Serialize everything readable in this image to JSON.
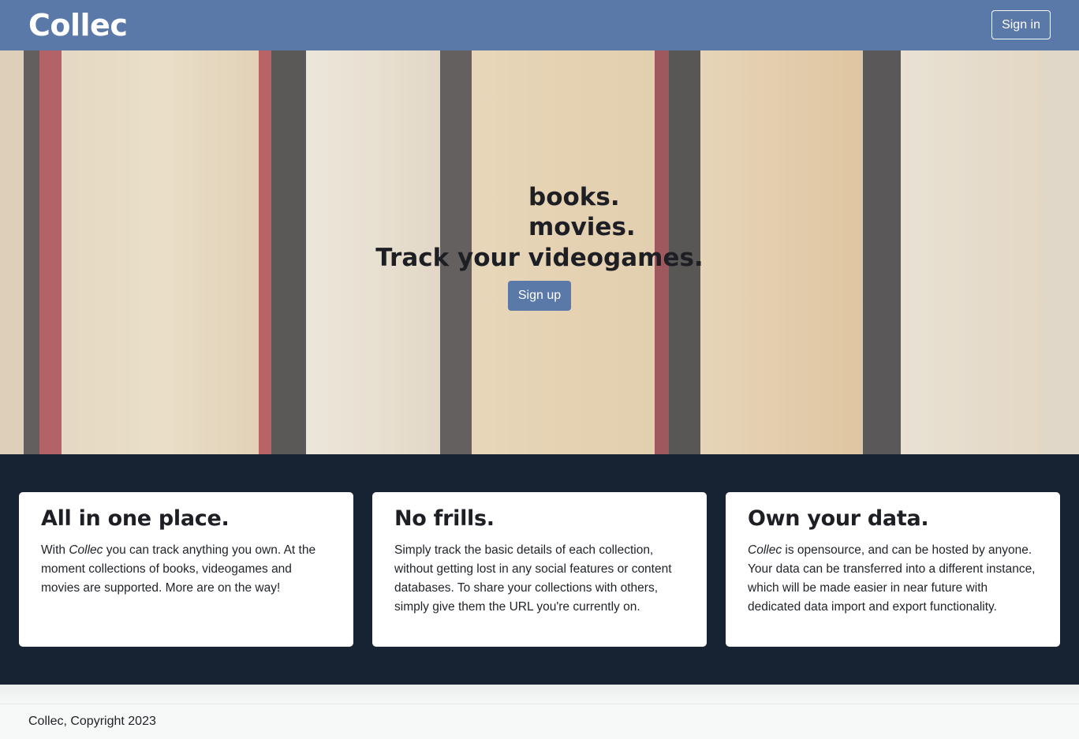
{
  "navbar": {
    "brand": "Collec",
    "signin_label": "Sign in"
  },
  "hero": {
    "rotating_words": [
      "books.",
      "movies."
    ],
    "title": "Track your videogames.",
    "signup_label": "Sign up"
  },
  "features": [
    {
      "title": "All in one place.",
      "before": "With ",
      "emphasis": "Collec",
      "after": " you can track anything you own. At the moment collections of books, videogames and movies are supported. More are on the way!"
    },
    {
      "title": "No frills.",
      "before": "",
      "emphasis": "",
      "after": "Simply track the basic details of each collection, without getting lost in any social features or content databases. To share your collections with others, simply give them the URL you're currently on."
    },
    {
      "title": "Own your data.",
      "before": "",
      "emphasis": "Collec",
      "after": " is opensource, and can be hosted by anyone. Your data can be transferred into a different instance, which will be made easier in near future with dedicated data import and export functionality."
    }
  ],
  "footer": {
    "text": "Collec, Copyright 2023"
  },
  "colors": {
    "primary": "#5b79a8",
    "features_bg": "#172233"
  }
}
